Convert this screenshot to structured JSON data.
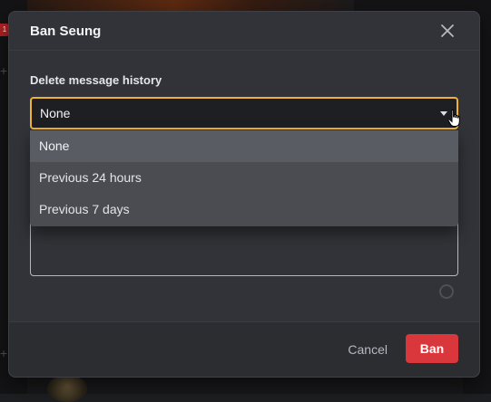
{
  "modal": {
    "title": "Ban Seung",
    "close_icon": "close-icon"
  },
  "delete_history": {
    "label": "Delete message history",
    "selected": "None",
    "options": [
      {
        "label": "None",
        "selected": true
      },
      {
        "label": "Previous 24 hours",
        "selected": false
      },
      {
        "label": "Previous 7 days",
        "selected": false
      }
    ]
  },
  "footer": {
    "cancel_label": "Cancel",
    "ban_label": "Ban"
  },
  "background": {
    "mention_badge": "1"
  },
  "colors": {
    "accent_focus": "#f0b232",
    "danger": "#da373c",
    "modal_bg": "#313338"
  }
}
